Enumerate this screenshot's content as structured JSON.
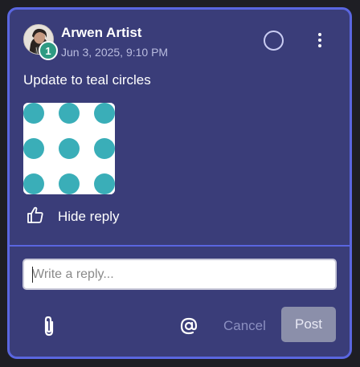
{
  "comment": {
    "author": "Arwen Artist",
    "timestamp": "Jun 3, 2025, 9:10 PM",
    "badge_count": "1",
    "text": "Update to teal circles",
    "image": {
      "background": "#ffffff",
      "dot_color": "#3aaeb8",
      "grid": [
        3,
        3
      ]
    }
  },
  "actions": {
    "like_icon": "thumbs-up-icon",
    "hide_reply_label": "Hide reply",
    "status_icon": "circle-outline-icon",
    "menu_icon": "kebab-menu-icon"
  },
  "reply": {
    "placeholder": "Write a reply...",
    "value": "",
    "attach_icon": "paperclip-icon",
    "mention_icon": "at-sign-icon",
    "cancel_label": "Cancel",
    "post_label": "Post"
  },
  "colors": {
    "card_bg": "#3a3d79",
    "card_border": "#5a66e0",
    "badge": "#2e9a82",
    "post_button": "#8b8faa"
  }
}
